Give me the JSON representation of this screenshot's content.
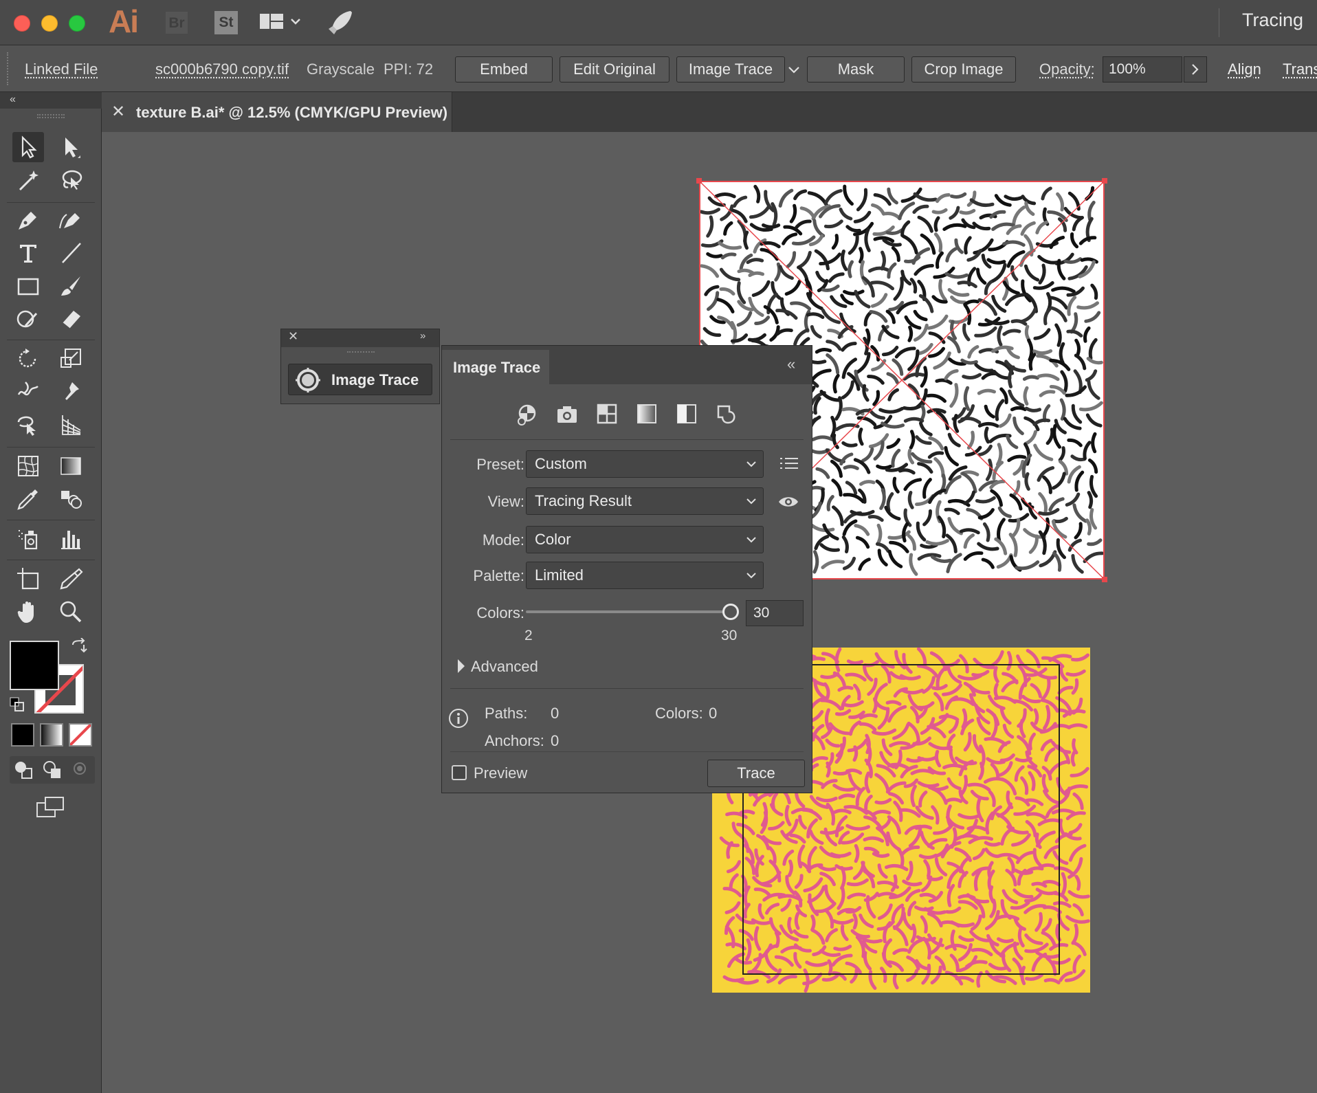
{
  "app": {
    "logo": "Ai",
    "bridge_logo": "Br",
    "stock_logo": "St",
    "workspace_title": "Tracing"
  },
  "control_bar": {
    "linked_file": "Linked File",
    "file_name": "sc000b6790 copy.tif",
    "color_mode": "Grayscale",
    "ppi": "PPI: 72",
    "embed_btn": "Embed",
    "edit_original_btn": "Edit Original",
    "image_trace_btn": "Image Trace",
    "mask_btn": "Mask",
    "crop_image_btn": "Crop Image",
    "opacity_label": "Opacity:",
    "opacity_value": "100%",
    "align_link": "Align",
    "transform_link": "Trans"
  },
  "document_tab": {
    "title": "texture B.ai* @ 12.5% (CMYK/GPU Preview)"
  },
  "mini_panel": {
    "image_trace_label": "Image Trace"
  },
  "image_trace_panel": {
    "title": "Image Trace",
    "preset": {
      "label": "Preset:",
      "value": "Custom"
    },
    "view": {
      "label": "View:",
      "value": "Tracing Result"
    },
    "mode": {
      "label": "Mode:",
      "value": "Color"
    },
    "palette": {
      "label": "Palette:",
      "value": "Limited"
    },
    "colors": {
      "label": "Colors:",
      "value": "30",
      "min": "2",
      "max": "30",
      "slider_fraction": 1.0
    },
    "advanced_label": "Advanced",
    "stats": {
      "paths_label": "Paths:",
      "paths_value": "0",
      "anchors_label": "Anchors:",
      "anchors_value": "0",
      "colors_label": "Colors:",
      "colors_value": "0"
    },
    "preview_label": "Preview",
    "preview_checked": false,
    "trace_btn": "Trace"
  },
  "colors": {
    "accent_red": "#e8474c",
    "texture_yellow": "#f7d43a",
    "texture_pink": "#e05a8f",
    "fill_swatch": "#000000"
  },
  "icons": [
    "pointer-icon",
    "direct-selection-icon",
    "magic-wand-icon",
    "lasso-icon",
    "pen-icon",
    "curvature-icon",
    "type-icon",
    "line-segment-icon",
    "rectangle-icon",
    "paintbrush-icon",
    "shaper-icon",
    "eraser-icon",
    "rotate-icon",
    "scale-icon",
    "warp-icon",
    "puppet-warp-icon",
    "free-transform-icon",
    "perspective-grid-icon",
    "mesh-icon",
    "gradient-icon",
    "eyedropper-icon",
    "blend-icon",
    "symbol-sprayer-icon",
    "column-graph-icon",
    "artboard-icon",
    "slice-icon",
    "hand-icon",
    "zoom-icon"
  ]
}
